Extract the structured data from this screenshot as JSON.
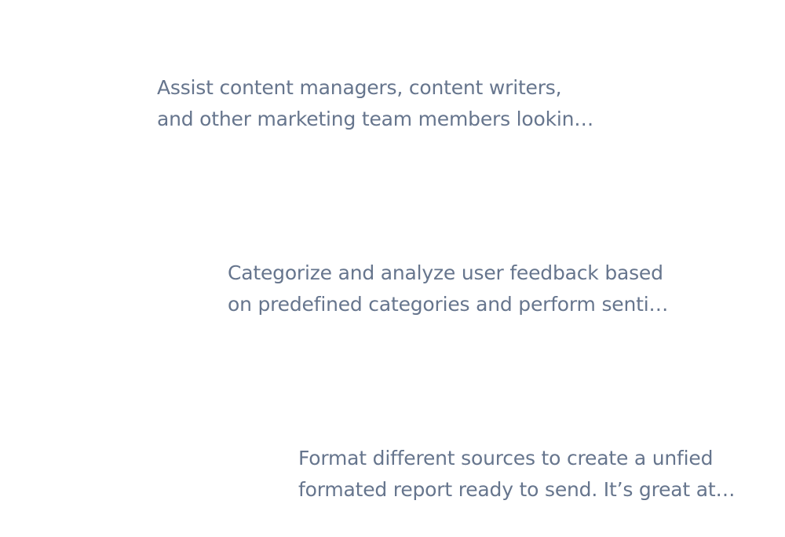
{
  "cards": [
    {
      "description_lines": [
        "Assist content managers, content writers,",
        "and other marketing team members lookin…"
      ]
    },
    {
      "description_lines": [
        "Categorize and analyze user feedback based",
        "on predefined categories and perform senti…"
      ]
    },
    {
      "description_lines": [
        "Format different sources to create a unfied",
        "formated report ready to send. It’s great at…"
      ]
    }
  ]
}
